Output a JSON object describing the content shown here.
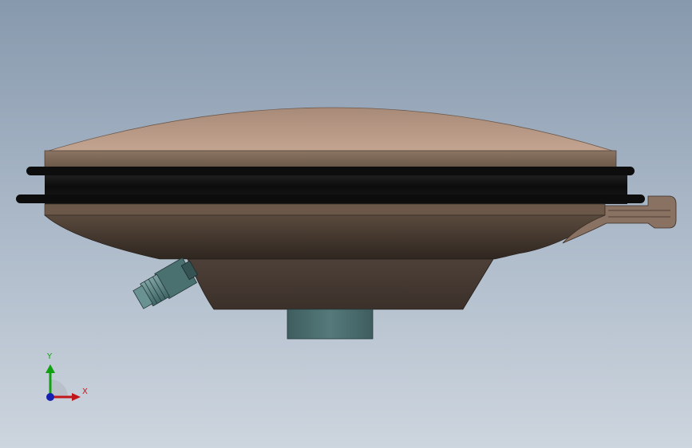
{
  "viewport": {
    "background_top": "#8799ad",
    "background_bottom": "#cdd5de"
  },
  "model": {
    "body_color": "#4a3d33",
    "dome_color": "#b39582",
    "gasket_color": "#111111",
    "mount_color": "#4d6f70",
    "connector_color": "#5d8282"
  },
  "triad": {
    "x_label": "X",
    "y_label": "Y",
    "x_color": "#c0181a",
    "y_color": "#11a011",
    "z_color": "#1520b0"
  }
}
